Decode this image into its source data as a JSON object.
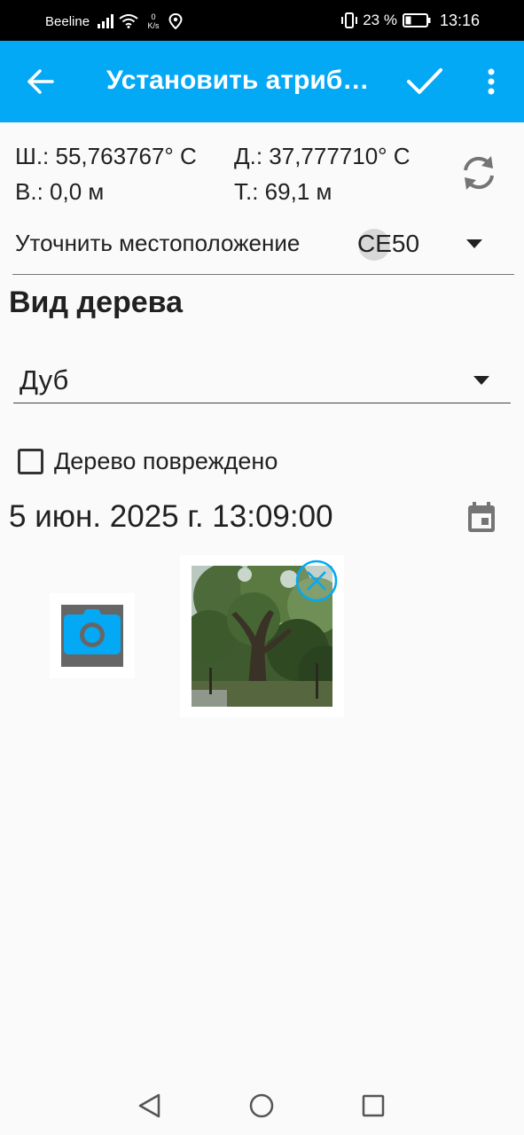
{
  "status_bar": {
    "carrier": "Beeline",
    "net_speed_value": "0",
    "net_speed_unit": "K/s",
    "battery_percent": "23 %",
    "time": "13:16",
    "icons": [
      "signal-icon",
      "wifi-icon",
      "location-icon",
      "vibrate-icon",
      "battery-icon"
    ]
  },
  "app_bar": {
    "title": "Установить атриб…",
    "back_icon": "arrow-left-icon",
    "confirm_icon": "check-icon",
    "menu_icon": "more-vert-icon"
  },
  "location": {
    "latitude": "Ш.: 55,763767° С",
    "longitude": "Д.: 37,777710° С",
    "altitude": "В.: 0,0 м",
    "accuracy": "Т.: 69,1 м",
    "refresh_icon": "refresh-icon",
    "refine_label": "Уточнить местоположение",
    "refine_value": "CE50"
  },
  "tree": {
    "section_title": "Вид дерева",
    "species_value": "Дуб",
    "damaged_label": "Дерево повреждено",
    "damaged_checked": false
  },
  "datetime": {
    "value": "5 июн. 2025 г. 13:09:00",
    "calendar_icon": "calendar-icon"
  },
  "attachments": {
    "camera_icon": "camera-icon",
    "remove_icon": "close-circle-icon"
  },
  "colors": {
    "accent": "#03a9f4",
    "status_bar": "#000000",
    "background": "#fafafa",
    "icon_gray": "#757575"
  },
  "nav_bar": {
    "icons": [
      "back-triangle-icon",
      "home-circle-icon",
      "recents-square-icon"
    ]
  }
}
